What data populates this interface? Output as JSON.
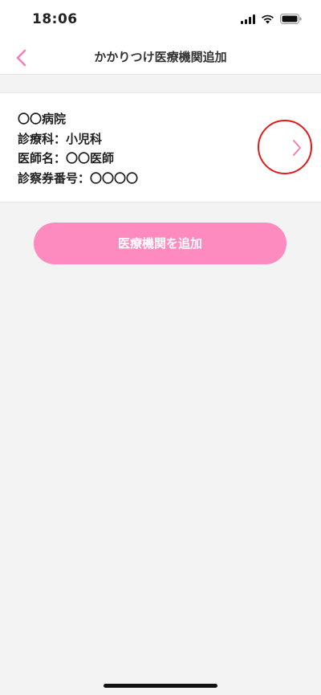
{
  "status_bar": {
    "time": "18:06"
  },
  "nav": {
    "title": "かかりつけ医療機関追加",
    "accent_color": "#f47fb6"
  },
  "card": {
    "lines": [
      "〇〇病院",
      "診療科：小児科",
      "医師名：〇〇医師",
      "診察券番号：〇〇〇〇"
    ],
    "highlight_color": "#e01b1b"
  },
  "add_button": {
    "label": "医療機関を追加",
    "color": "#fd8bbf"
  }
}
